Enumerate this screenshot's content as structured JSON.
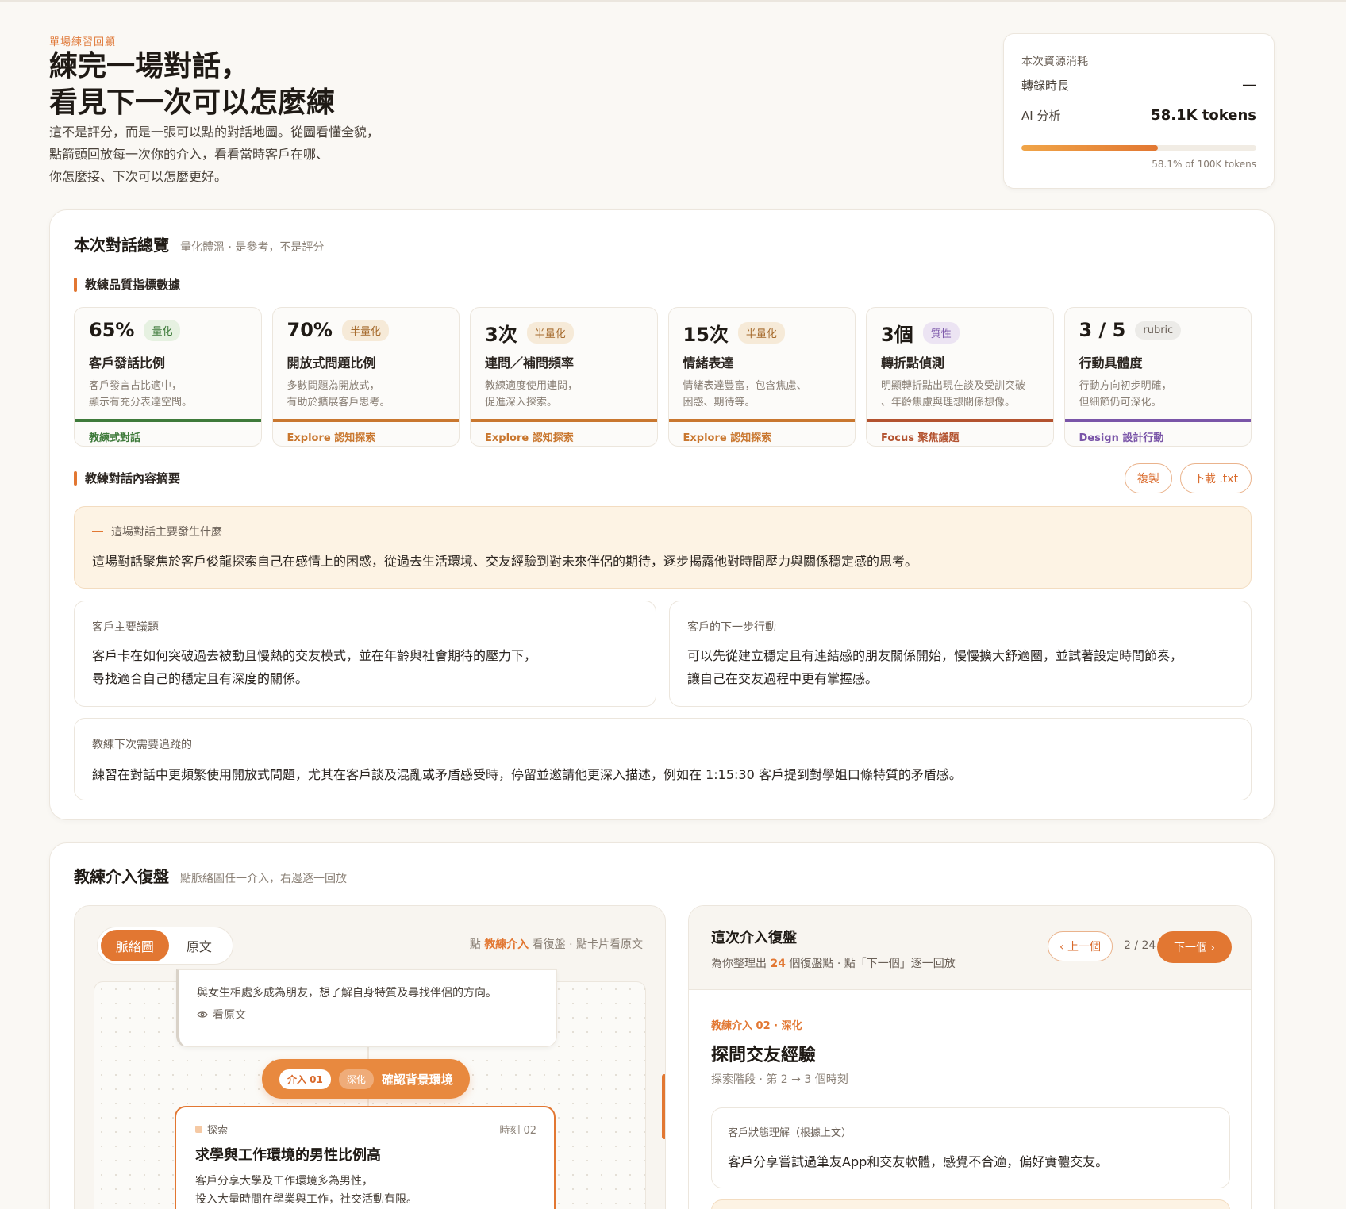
{
  "header": {
    "eyebrow": "單場練習回顧",
    "title_line1": "練完一場對話，",
    "title_line2": "看見下一次可以怎麼練",
    "desc_line1": "這不是評分，而是一張可以點的對話地圖。從圖看懂全貌，",
    "desc_line2": "點箭頭回放每一次你的介入，看看當時客戶在哪、",
    "desc_line3": "你怎麼接、下次可以怎麼更好。"
  },
  "resource": {
    "title": "本次資源消耗",
    "transcribe_label": "轉錄時長",
    "transcribe_value": "—",
    "ai_label": "AI 分析",
    "ai_value": "58.1K tokens",
    "usage_fraction": 0.581,
    "usage_note": "58.1% of 100K tokens"
  },
  "overview": {
    "title": "本次對話總覽",
    "subtitle": "量化體溫 · 是參考，不是評分",
    "metrics_label": "教練品質指標數據",
    "metrics": [
      {
        "value": "65%",
        "tag": "量化",
        "name": "客戶發話比例",
        "desc1": "客戶發言占比適中，",
        "desc2": "顯示有充分表達空間。",
        "foot": "教練式對話",
        "accent": "#3e7a3a",
        "tag_bg": "#e6f1e1",
        "tag_fg": "#3e7a3a"
      },
      {
        "value": "70%",
        "tag": "半量化",
        "name": "開放式問題比例",
        "desc1": "多數問題為開放式，",
        "desc2": "有助於擴展客戶思考。",
        "foot": "Explore 認知探索",
        "accent": "#c9772f",
        "tag_bg": "#f6ead8",
        "tag_fg": "#a56a2c"
      },
      {
        "value": "3次",
        "tag": "半量化",
        "name": "連問／補問頻率",
        "desc1": "教練適度使用連問，",
        "desc2": "促進深入探索。",
        "foot": "Explore 認知探索",
        "accent": "#c9772f",
        "tag_bg": "#f6ead8",
        "tag_fg": "#a56a2c"
      },
      {
        "value": "15次",
        "tag": "半量化",
        "name": "情緒表達",
        "desc1": "情緒表達豐富，包含焦慮、",
        "desc2": "困惑、期待等。",
        "foot": "Explore 認知探索",
        "accent": "#c9772f",
        "tag_bg": "#f6ead8",
        "tag_fg": "#a56a2c"
      },
      {
        "value": "3個",
        "tag": "質性",
        "name": "轉折點偵測",
        "desc1": "明顯轉折點出現在談及受訓突破",
        "desc2": "、年齡焦慮與理想關係想像。",
        "foot": "Focus 聚焦議題",
        "accent": "#b3522f",
        "tag_bg": "#ece4f3",
        "tag_fg": "#7a55a8"
      },
      {
        "value": "3 / 5",
        "tag": "rubric",
        "name": "行動具體度",
        "desc1": "行動方向初步明確，",
        "desc2": "但細節仍可深化。",
        "foot": "Design 設計行動",
        "accent": "#7a55a8",
        "tag_bg": "#ecebe8",
        "tag_fg": "#6b6158"
      }
    ],
    "summary_label": "教練對話內容摘要",
    "copy_btn": "複製",
    "download_btn": "下載 .txt",
    "what_label": "這場對話主要發生什麼",
    "what_text": "這場對話聚焦於客戶俊龍探索自己在感情上的困惑，從過去生活環境、交友經驗到對未來伴侶的期待，逐步揭露他對時間壓力與關係穩定感的思考。",
    "issue_label": "客戶主要議題",
    "issue_line1": "客戶卡在如何突破過去被動且慢熱的交友模式，並在年齡與社會期待的壓力下，",
    "issue_line2": "尋找適合自己的穩定且有深度的關係。",
    "next_label": "客戶的下一步行動",
    "next_line1": "可以先從建立穩定且有連結感的朋友關係開始，慢慢擴大舒適圈，並試著設定時間節奏，",
    "next_line2": "讓自己在交友過程中更有掌握感。",
    "track_label": "教練下次需要追蹤的",
    "track_text": "練習在對話中更頻繁使用開放式問題，尤其在客戶談及混亂或矛盾感受時，停留並邀請他更深入描述，例如在 1:15:30 客戶提到對學姐口條特質的矛盾感。"
  },
  "review": {
    "title": "教練介入復盤",
    "subtitle": "點脈絡圖任一介入，右邊逐一回放",
    "tab_map": "脈絡圖",
    "tab_raw": "原文",
    "hint_pre": "點 ",
    "hint_hl": "教練介入",
    "hint_post": " 看復盤 · 點卡片看原文",
    "node_top_text": "與女生相處多成為朋友，想了解自身特質及尋找伴侶的方向。",
    "node_top_view": "看原文",
    "pill_tag1": "介入 01",
    "pill_tag2": "深化",
    "pill_text": "確認背景環境",
    "sel_kind": "探索",
    "sel_time": "時刻 02",
    "sel_title": "求學與工作環境的男性比例高",
    "sel_line1": "客戶分享大學及工作環境多為男性，",
    "sel_line2": "投入大量時間在學業與工作，社交活動有限。",
    "panel_title": "這次介入復盤",
    "panel_sub_pre": "為你整理出 ",
    "panel_sub_num": "24",
    "panel_sub_post": " 個復盤點 · 點「下一個」逐一回放",
    "prev_btn": "‹ 上一個",
    "counter": "2 / 24",
    "next_btn": "下一個 ›",
    "item_kicker": "教練介入 02 · 深化",
    "item_title": "探問交友經驗",
    "item_sub": "探索階段 · 第 2 → 3 個時刻",
    "state_label": "客戶狀態理解（根據上文）",
    "state_text": "客戶分享嘗試過筆友App和交友軟體，感覺不合適，偏好實體交友。"
  }
}
